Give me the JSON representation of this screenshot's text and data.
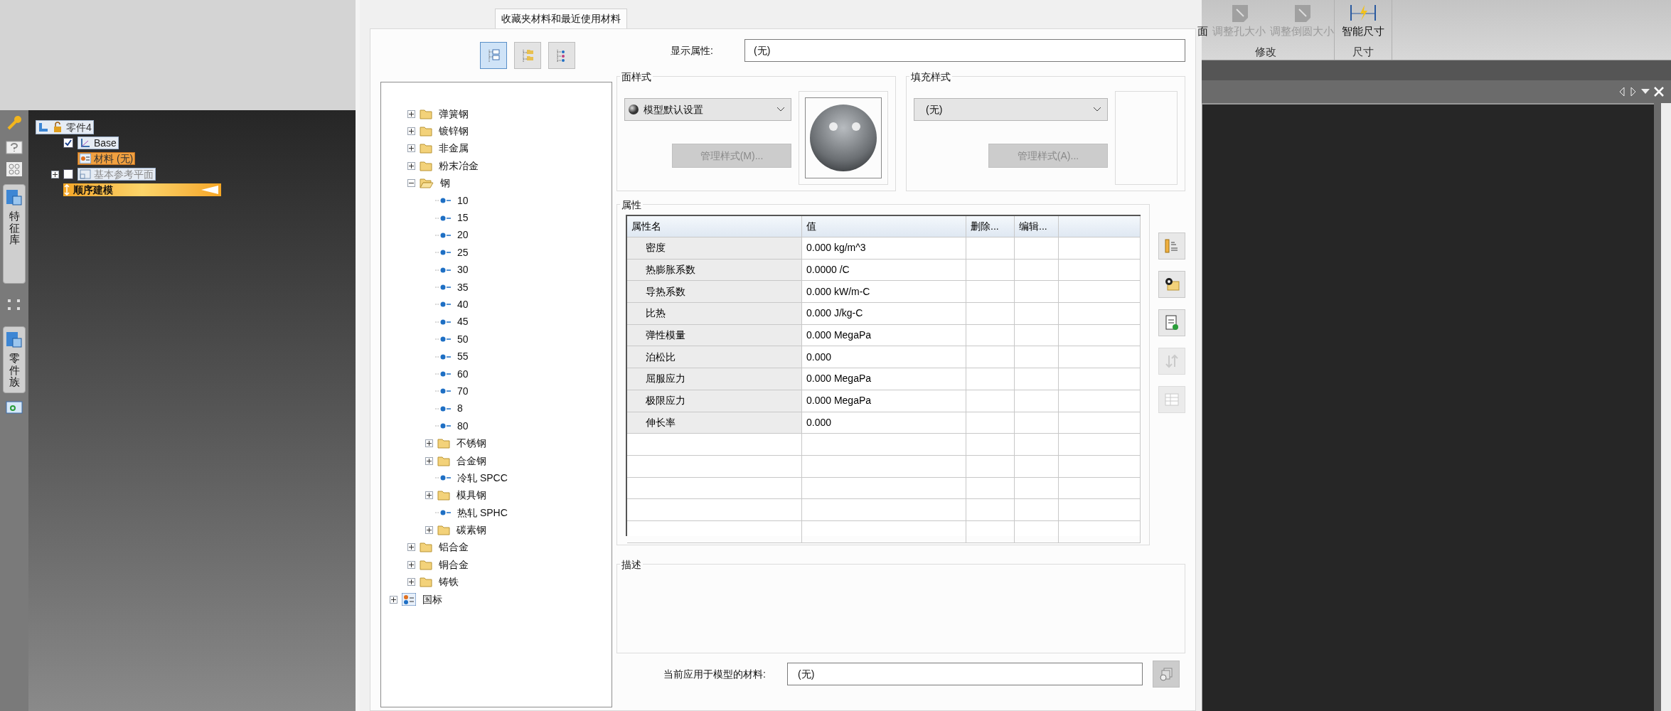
{
  "ribbon": {
    "groups": [
      {
        "label": "修改",
        "commands": [
          {
            "label": "面",
            "disabled": false
          },
          {
            "label": "调整孔大小",
            "disabled": true
          },
          {
            "label": "调整倒圆大小",
            "disabled": true
          }
        ]
      },
      {
        "label": "尺寸",
        "commands": [
          {
            "label": "智能尺寸",
            "disabled": false
          }
        ]
      }
    ]
  },
  "side_tabs": [
    {
      "label": "特征库"
    },
    {
      "label": "零件族"
    }
  ],
  "pathfinder": {
    "items": [
      {
        "label": "零件4",
        "kind": "part",
        "children": [
          {
            "label": "Base",
            "kind": "csys",
            "checked": true
          },
          {
            "label": "材料 (无)",
            "kind": "material"
          },
          {
            "label": "基本参考平面",
            "kind": "planes",
            "checked": false,
            "expanded": false
          },
          {
            "label": "顺序建模",
            "kind": "mode"
          }
        ]
      }
    ]
  },
  "dialog": {
    "tabs": [
      {
        "label": "收藏夹材料和最近使用材料",
        "selected": true
      }
    ],
    "toolbar_buttons": [
      {
        "selected": true
      },
      {
        "selected": false
      },
      {
        "selected": false
      }
    ],
    "tree": {
      "items": [
        {
          "label": "弹簧钢",
          "kind": "folder",
          "expanded": false
        },
        {
          "label": "镀锌钢",
          "kind": "folder",
          "expanded": false
        },
        {
          "label": "非金属",
          "kind": "folder",
          "expanded": false
        },
        {
          "label": "粉末冶金",
          "kind": "folder",
          "expanded": false
        },
        {
          "label": "钢",
          "kind": "folder",
          "expanded": true,
          "children": [
            {
              "label": "10",
              "kind": "material"
            },
            {
              "label": "15",
              "kind": "material"
            },
            {
              "label": "20",
              "kind": "material"
            },
            {
              "label": "25",
              "kind": "material"
            },
            {
              "label": "30",
              "kind": "material"
            },
            {
              "label": "35",
              "kind": "material"
            },
            {
              "label": "40",
              "kind": "material"
            },
            {
              "label": "45",
              "kind": "material"
            },
            {
              "label": "50",
              "kind": "material"
            },
            {
              "label": "55",
              "kind": "material"
            },
            {
              "label": "60",
              "kind": "material"
            },
            {
              "label": "70",
              "kind": "material"
            },
            {
              "label": "8",
              "kind": "material"
            },
            {
              "label": "80",
              "kind": "material"
            },
            {
              "label": "不锈钢",
              "kind": "folder",
              "expanded": false
            },
            {
              "label": "合金钢",
              "kind": "folder",
              "expanded": false
            },
            {
              "label": "冷轧 SPCC",
              "kind": "material"
            },
            {
              "label": "模具钢",
              "kind": "folder",
              "expanded": false
            },
            {
              "label": "热轧 SPHC",
              "kind": "material"
            },
            {
              "label": "碳素钢",
              "kind": "folder",
              "expanded": false
            }
          ]
        },
        {
          "label": "铝合金",
          "kind": "folder",
          "expanded": false
        },
        {
          "label": "铜合金",
          "kind": "folder",
          "expanded": false
        },
        {
          "label": "铸铁",
          "kind": "folder",
          "expanded": false
        }
      ],
      "libraries": [
        {
          "label": "国标",
          "expanded": false
        }
      ]
    },
    "display_property": {
      "label": "显示属性:",
      "value": "(无)"
    },
    "face_style": {
      "title": "面样式",
      "value": "模型默认设置",
      "button": "管理样式(M)...",
      "button_disabled": true
    },
    "fill_style": {
      "title": "填充样式",
      "value": "(无)",
      "button": "管理样式(A)...",
      "button_disabled": true
    },
    "properties": {
      "title": "属性",
      "columns": [
        "属性名",
        "值",
        "删除...",
        "编辑..."
      ],
      "rows": [
        [
          "密度",
          "0.000 kg/m^3"
        ],
        [
          "热膨胀系数",
          "0.0000 /C"
        ],
        [
          "导热系数",
          "0.000 kW/m-C"
        ],
        [
          "比热",
          "0.000 J/kg-C"
        ],
        [
          "弹性模量",
          "0.000 MegaPa"
        ],
        [
          "泊松比",
          "0.000"
        ],
        [
          "屈服应力",
          "0.000 MegaPa"
        ],
        [
          "极限应力",
          "0.000 MegaPa"
        ],
        [
          "伸长率",
          "0.000"
        ]
      ],
      "side_buttons": [
        {
          "kind": "units",
          "disabled": false
        },
        {
          "kind": "locate",
          "disabled": false
        },
        {
          "kind": "add",
          "disabled": false
        },
        {
          "kind": "swap",
          "disabled": true
        },
        {
          "kind": "table",
          "disabled": true
        }
      ]
    },
    "description": {
      "title": "描述"
    },
    "current_material": {
      "label": "当前应用于模型的材料:",
      "value": "(无)"
    }
  }
}
